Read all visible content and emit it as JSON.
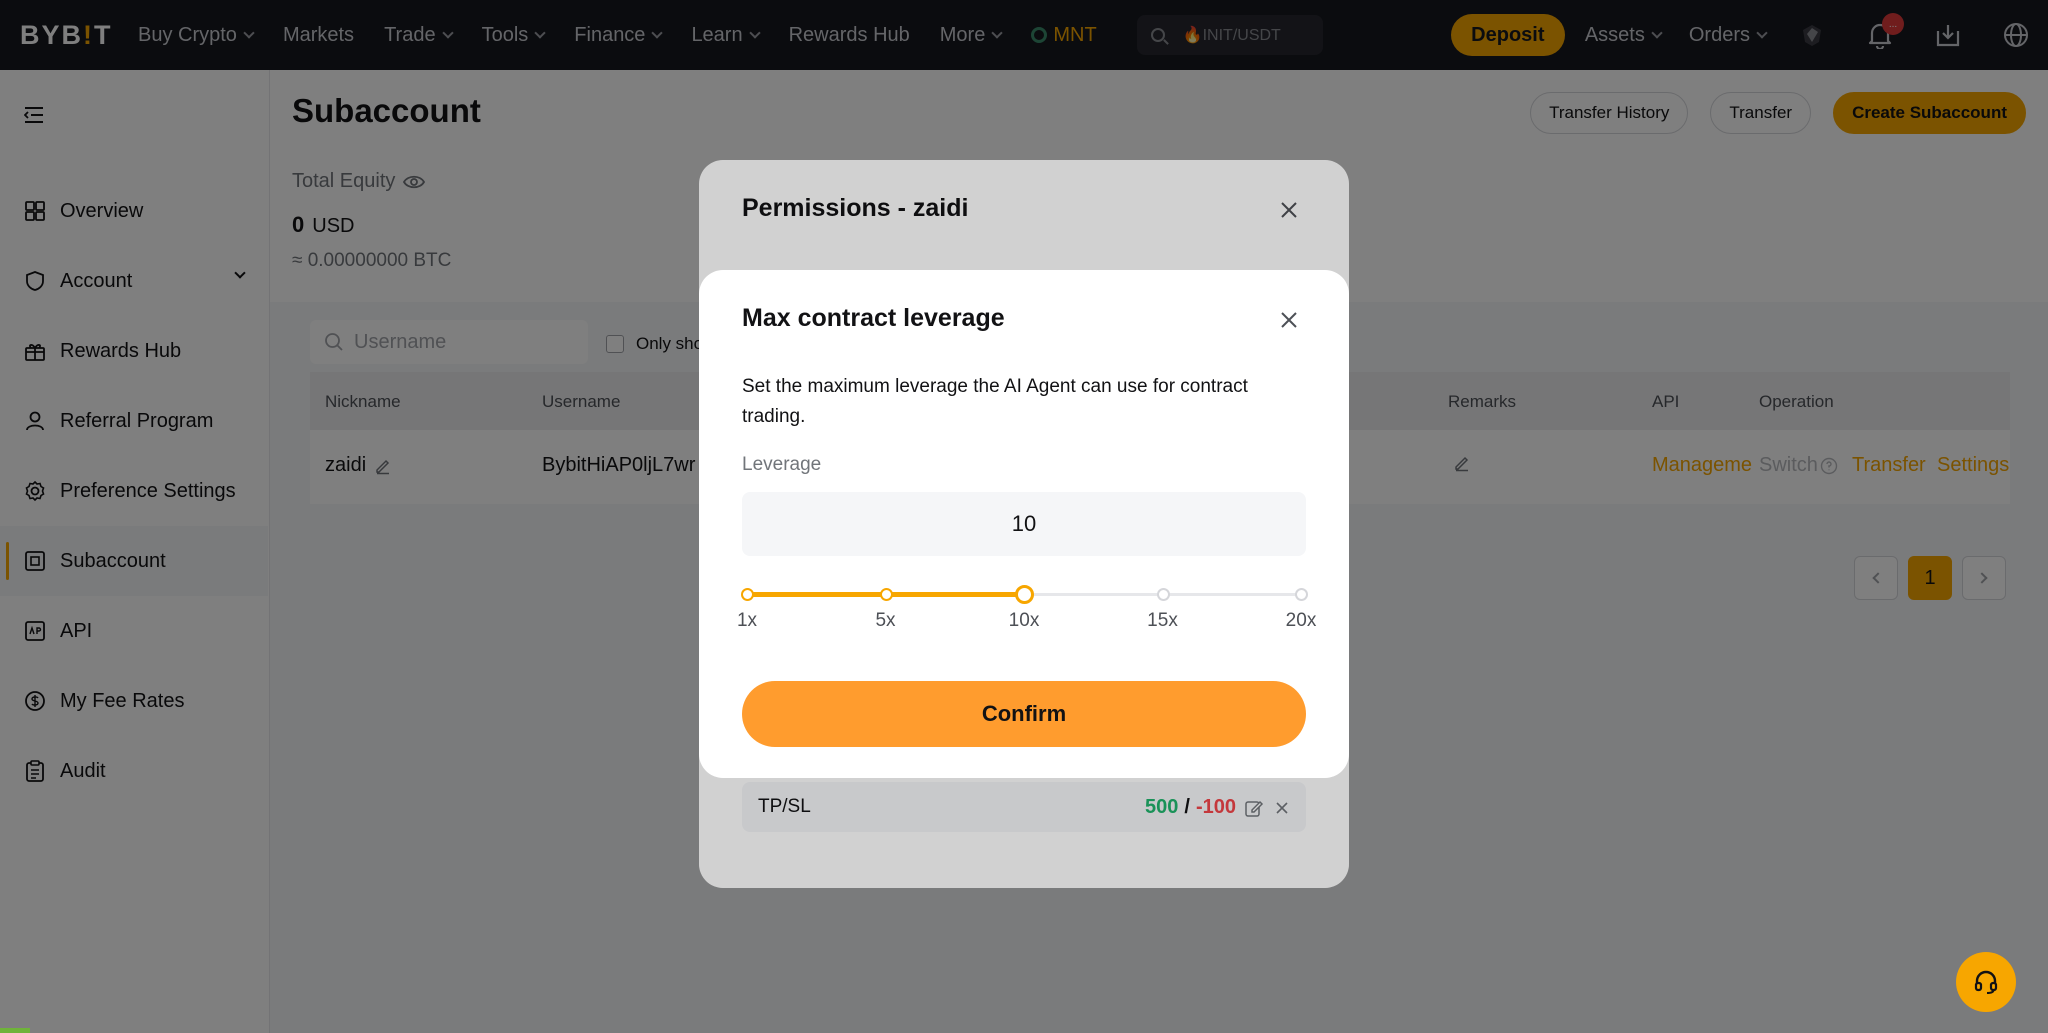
{
  "brand": {
    "logo_left": "BYB",
    "logo_i": "!",
    "logo_right": "T"
  },
  "nav": {
    "items": [
      {
        "label": "Buy Crypto",
        "dropdown": true
      },
      {
        "label": "Markets",
        "dropdown": false
      },
      {
        "label": "Trade",
        "dropdown": true
      },
      {
        "label": "Tools",
        "dropdown": true
      },
      {
        "label": "Finance",
        "dropdown": true
      },
      {
        "label": "Learn",
        "dropdown": true
      },
      {
        "label": "Rewards Hub",
        "dropdown": false
      },
      {
        "label": "More",
        "dropdown": true
      }
    ],
    "mnt": "MNT",
    "search_placeholder": "🔥INIT/USDT",
    "deposit": "Deposit",
    "assets": "Assets",
    "orders": "Orders",
    "notification_badge": "..."
  },
  "sidebar": {
    "items": [
      {
        "label": "Overview",
        "icon": "overview-icon"
      },
      {
        "label": "Account",
        "icon": "shield-icon",
        "expandable": true
      },
      {
        "label": "Rewards Hub",
        "icon": "gift-icon"
      },
      {
        "label": "Referral Program",
        "icon": "person-icon"
      },
      {
        "label": "Preference Settings",
        "icon": "gear-icon"
      },
      {
        "label": "Subaccount",
        "icon": "subaccount-icon",
        "active": true
      },
      {
        "label": "API",
        "icon": "api-icon"
      },
      {
        "label": "My Fee Rates",
        "icon": "fee-icon"
      },
      {
        "label": "Audit",
        "icon": "audit-icon"
      }
    ]
  },
  "page": {
    "title": "Subaccount",
    "buttons": {
      "history": "Transfer History",
      "transfer": "Transfer",
      "create": "Create Subaccount"
    },
    "equity": {
      "label": "Total Equity",
      "value": "0",
      "currency": "USD",
      "btc": "≈ 0.00000000 BTC"
    },
    "search_placeholder": "Username",
    "checkbox_label": "Only sho",
    "table": {
      "headers": [
        "Nickname",
        "Username",
        "Remarks",
        "API",
        "Operation"
      ],
      "row": {
        "nickname": "zaidi",
        "username": "BybitHiAP0ljL7wr",
        "api": "Manageme",
        "switch": "Switch",
        "transfer": "Transfer",
        "settings": "Settings"
      }
    },
    "pagination": {
      "current": "1"
    }
  },
  "permissions_modal": {
    "title": "Permissions - zaidi",
    "tpsl_label": "TP/SL",
    "tp_value": "500",
    "separator": "/",
    "sl_value": "-100"
  },
  "leverage_modal": {
    "title": "Max contract leverage",
    "description": "Set the maximum leverage the AI Agent can use for contract trading.",
    "label": "Leverage",
    "value": "10",
    "slider": {
      "min": 1,
      "max": 20,
      "value": 10,
      "ticks": [
        "1x",
        "5x",
        "10x",
        "15x",
        "20x"
      ]
    },
    "confirm": "Confirm"
  },
  "colors": {
    "accent": "#f7a600",
    "nav_bg": "#17181e",
    "confirm": "#ff9c2e",
    "tp": "#20b26c",
    "sl": "#ef454a"
  }
}
